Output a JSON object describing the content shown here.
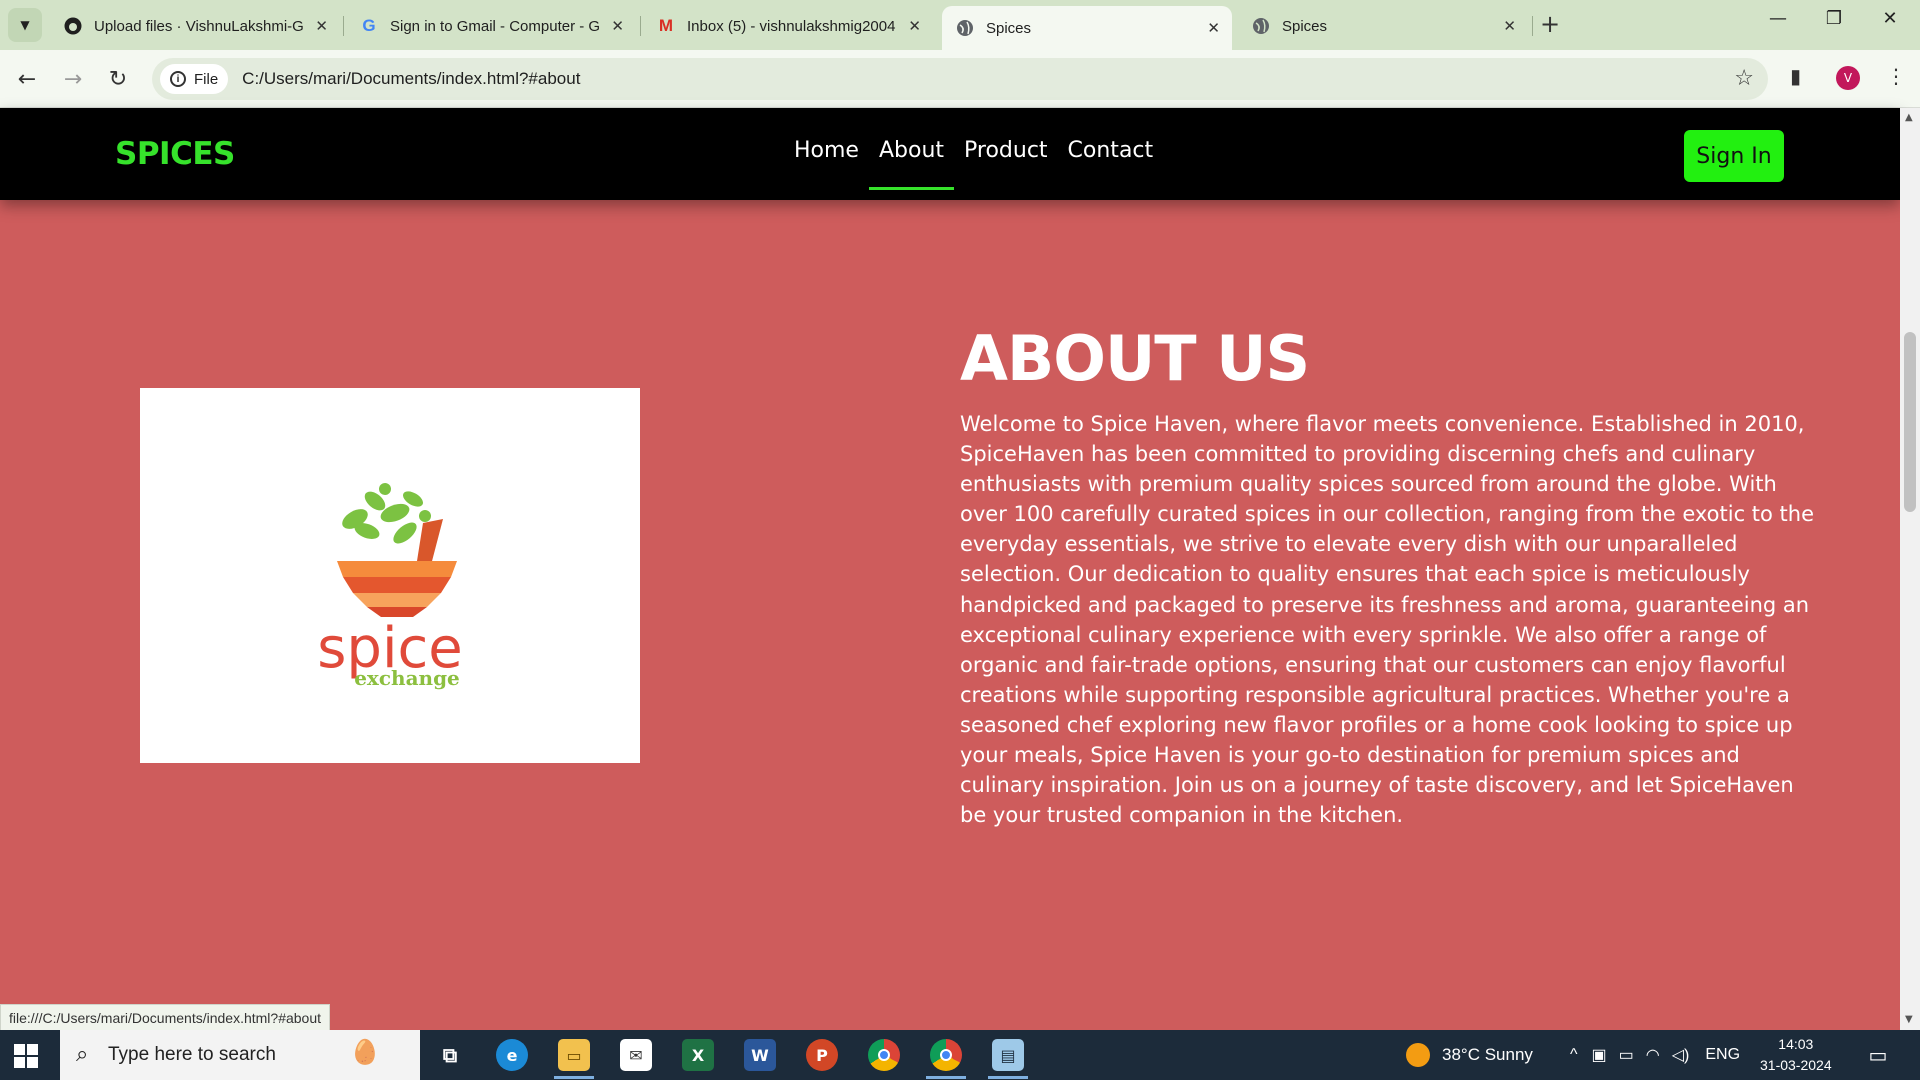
{
  "browser": {
    "tabs": [
      {
        "title": "Upload files · VishnuLakshmi-G",
        "icon": "github-icon"
      },
      {
        "title": "Sign in to Gmail - Computer - G",
        "icon": "google-icon"
      },
      {
        "title": "Inbox (5) - vishnulakshmig2004",
        "icon": "gmail-icon"
      },
      {
        "title": "Spices",
        "icon": "globe-icon",
        "active": true
      },
      {
        "title": "Spices",
        "icon": "globe-icon"
      }
    ],
    "omnibox_chip": "File",
    "url": "C:/Users/mari/Documents/index.html?#about",
    "profile_initial": "V",
    "status_url": "file:///C:/Users/mari/Documents/index.html?#about"
  },
  "site": {
    "brand": "SPICES",
    "nav": [
      {
        "label": "Home"
      },
      {
        "label": "About",
        "active": true
      },
      {
        "label": "Product"
      },
      {
        "label": "Contact"
      }
    ],
    "signin_label": "Sign In",
    "colors": {
      "brand": "#36e22b",
      "signin_bg": "#22f010",
      "page_bg": "#ce5c5c",
      "nav_bg": "#000000"
    }
  },
  "about": {
    "title": "ABOUT US",
    "body": "Welcome to Spice Haven, where flavor meets convenience. Established in 2010, SpiceHaven has been committed to providing discerning chefs and culinary enthusiasts with premium quality spices sourced from around the globe. With over 100 carefully curated spices in our collection, ranging from the exotic to the everyday essentials, we strive to elevate every dish with our unparalleled selection. Our dedication to quality ensures that each spice is meticulously handpicked and packaged to preserve its freshness and aroma, guaranteeing an exceptional culinary experience with every sprinkle. We also offer a range of organic and fair-trade options, ensuring that our customers can enjoy flavorful creations while supporting responsible agricultural practices. Whether you're a seasoned chef exploring new flavor profiles or a home cook looking to spice up your meals, Spice Haven is your go-to destination for premium spices and culinary inspiration. Join us on a journey of taste discovery, and let SpiceHaven be your trusted companion in the kitchen.",
    "logo_word": "spice",
    "logo_sub": "exchange"
  },
  "taskbar": {
    "search_placeholder": "Type here to search",
    "weather": "38°C  Sunny",
    "language": "ENG",
    "time": "14:03",
    "date": "31-03-2024"
  }
}
